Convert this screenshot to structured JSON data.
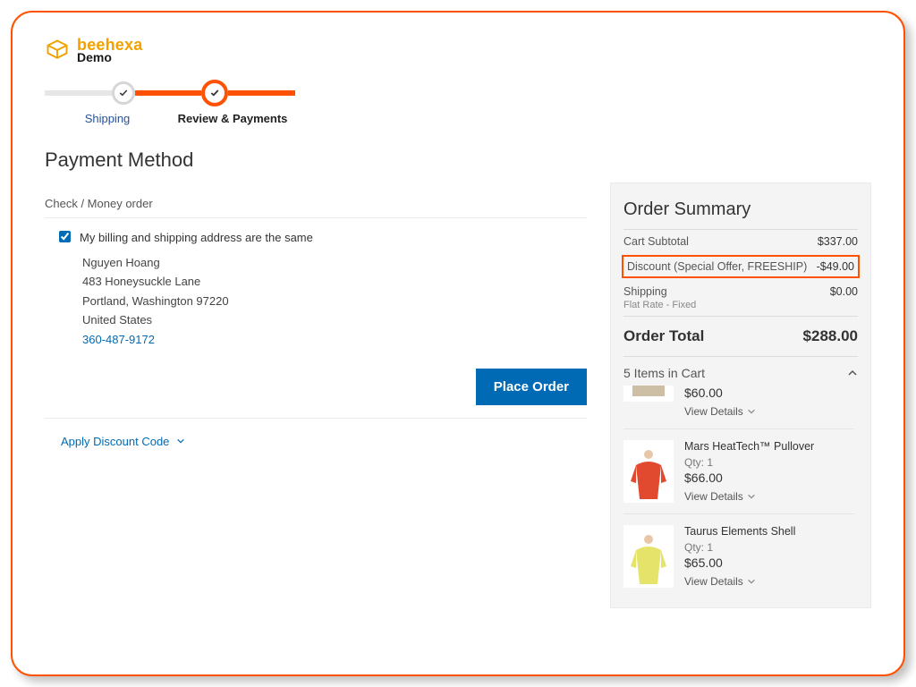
{
  "brand": {
    "name": "beehexa",
    "sub": "Demo"
  },
  "stepper": {
    "step1": "Shipping",
    "step2": "Review & Payments"
  },
  "payment": {
    "title": "Payment Method",
    "method": "Check / Money order",
    "same_address_label": "My billing and shipping address are the same",
    "address": {
      "name": "Nguyen Hoang",
      "street": "483 Honeysuckle Lane",
      "city_line": "Portland, Washington 97220",
      "country": "United States",
      "phone": "360-487-9172"
    },
    "place_order": "Place Order",
    "discount_toggle": "Apply Discount Code"
  },
  "summary": {
    "title": "Order Summary",
    "subtotal_label": "Cart Subtotal",
    "subtotal_value": "$337.00",
    "discount_label": "Discount (Special Offer, FREESHIP)",
    "discount_value": "-$49.00",
    "shipping_label": "Shipping",
    "shipping_value": "$0.00",
    "shipping_method": "Flat Rate - Fixed",
    "total_label": "Order Total",
    "total_value": "$288.00",
    "cart_count_label": "5 Items in Cart",
    "view_details": "View Details",
    "items": [
      {
        "name": "",
        "qty": "",
        "price": "$60.00",
        "color": "#cdbfa6"
      },
      {
        "name": "Mars HeatTech™ Pullover",
        "qty": "Qty: 1",
        "price": "$66.00",
        "color": "#e24a2f"
      },
      {
        "name": "Taurus Elements Shell",
        "qty": "Qty: 1",
        "price": "$65.00",
        "color": "#e6e36a"
      }
    ]
  }
}
